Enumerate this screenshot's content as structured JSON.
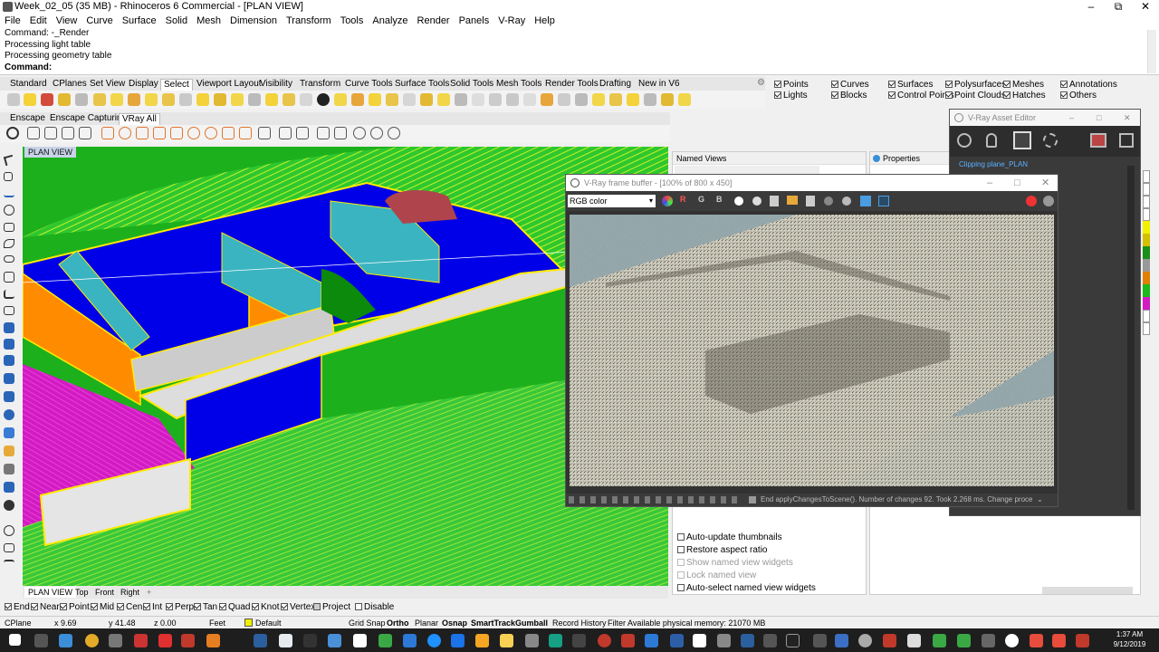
{
  "titlebar": {
    "title": "Week_02_05 (35 MB) - Rhinoceros 6 Commercial - [PLAN VIEW]",
    "min": "–",
    "max": "⧉",
    "close": "✕"
  },
  "menu": [
    "File",
    "Edit",
    "View",
    "Curve",
    "Surface",
    "Solid",
    "Mesh",
    "Dimension",
    "Transform",
    "Tools",
    "Analyze",
    "Render",
    "Panels",
    "V-Ray",
    "Help"
  ],
  "command": {
    "lines": [
      "Command: -_Render",
      "Processing light table",
      "Processing geometry table"
    ],
    "prompt": "Command:"
  },
  "toolbar_tabs": [
    "Standard",
    "CPlanes",
    "Set View",
    "Display",
    "Select",
    "Viewport Layout",
    "Visibility",
    "Transform",
    "Curve Tools",
    "Surface Tools",
    "Solid Tools",
    "Mesh Tools",
    "Render Tools",
    "Drafting",
    "New in V6"
  ],
  "active_toolbar_tab": "Select",
  "select_filters": [
    {
      "label": "Points",
      "checked": true
    },
    {
      "label": "Lights",
      "checked": true
    },
    {
      "label": "Curves",
      "checked": true
    },
    {
      "label": "Blocks",
      "checked": true
    },
    {
      "label": "Surfaces",
      "checked": true
    },
    {
      "label": "Control Points",
      "checked": true
    },
    {
      "label": "Polysurfaces",
      "checked": true
    },
    {
      "label": "Point Clouds",
      "checked": true
    },
    {
      "label": "Meshes",
      "checked": true
    },
    {
      "label": "Hatches",
      "checked": true
    },
    {
      "label": "Annotations",
      "checked": true
    },
    {
      "label": "Others",
      "checked": true
    }
  ],
  "plugin_tabs": [
    "Enscape",
    "Enscape Capturing",
    "VRay All"
  ],
  "viewport": {
    "label": "PLAN VIEW"
  },
  "view_tabs": [
    "PLAN VIEW",
    "Top",
    "Front",
    "Right"
  ],
  "named_views": {
    "title": "Named Views",
    "options": [
      {
        "label": "Auto-update thumbnails",
        "checked": false,
        "enabled": true
      },
      {
        "label": "Restore aspect ratio",
        "checked": false,
        "enabled": true
      },
      {
        "label": "Show named view widgets",
        "checked": false,
        "enabled": false
      },
      {
        "label": "Lock named view",
        "checked": false,
        "enabled": false
      },
      {
        "label": "Auto-select named view widgets",
        "checked": false,
        "enabled": true
      }
    ]
  },
  "properties": {
    "title": "Properties"
  },
  "vfb": {
    "title": "V-Ray frame buffer - [100% of 800 x 450]",
    "channel": "RGB color",
    "rgb": [
      "R",
      "G",
      "B"
    ],
    "status": "End applyChangesToScene(). Number of changes 92. Took 2.268 ms. Change process"
  },
  "asset_editor": {
    "title": "V-Ray Asset Editor",
    "item": "Clipping plane_PLAN"
  },
  "osnaps": [
    {
      "label": "End",
      "checked": true
    },
    {
      "label": "Near",
      "checked": true
    },
    {
      "label": "Point",
      "checked": true
    },
    {
      "label": "Mid",
      "checked": true
    },
    {
      "label": "Cen",
      "checked": true
    },
    {
      "label": "Int",
      "checked": true
    },
    {
      "label": "Perp",
      "checked": true
    },
    {
      "label": "Tan",
      "checked": true
    },
    {
      "label": "Quad",
      "checked": true
    },
    {
      "label": "Knot",
      "checked": true
    },
    {
      "label": "Vertex",
      "checked": true
    },
    {
      "label": "Project",
      "checked": false
    },
    {
      "label": "Disable",
      "checked": false
    }
  ],
  "statusbar": {
    "cplane": "CPlane",
    "x": "x 9.69",
    "y": "y 41.48",
    "z": "z 0.00",
    "units": "Feet",
    "layer": "Default",
    "grid_snap": "Grid Snap",
    "ortho": "Ortho",
    "planar": "Planar",
    "osnap": "Osnap",
    "smarttrack": "SmartTrack",
    "gumball": "Gumball",
    "record_history": "Record History",
    "filter": "Filter",
    "memory": "Available physical memory: 21070 MB"
  },
  "clock": {
    "time": "1:37 AM",
    "date": "9/12/2019"
  },
  "colors": {
    "viewport_bg": "#1db01d",
    "vray_accent": "#2d7fd6",
    "taskbar": "#1e1e1e"
  }
}
